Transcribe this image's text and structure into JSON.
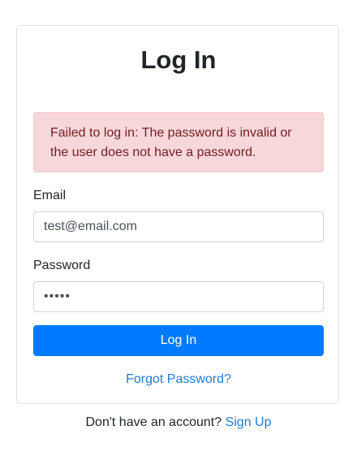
{
  "login": {
    "title": "Log In",
    "error_message": "Failed to log in: The password is invalid or the user does not have a password.",
    "email_label": "Email",
    "email_value": "test@email.com",
    "password_label": "Password",
    "password_value": "•••••",
    "submit_label": "Log In",
    "forgot_password_link": "Forgot Password?"
  },
  "footer": {
    "prompt": "Don't have an account?",
    "signup_link": "Sign Up"
  },
  "colors": {
    "primary": "#007bff",
    "link": "#1f7bd6",
    "alert_bg": "#f8d7da",
    "alert_text": "#721c24"
  }
}
